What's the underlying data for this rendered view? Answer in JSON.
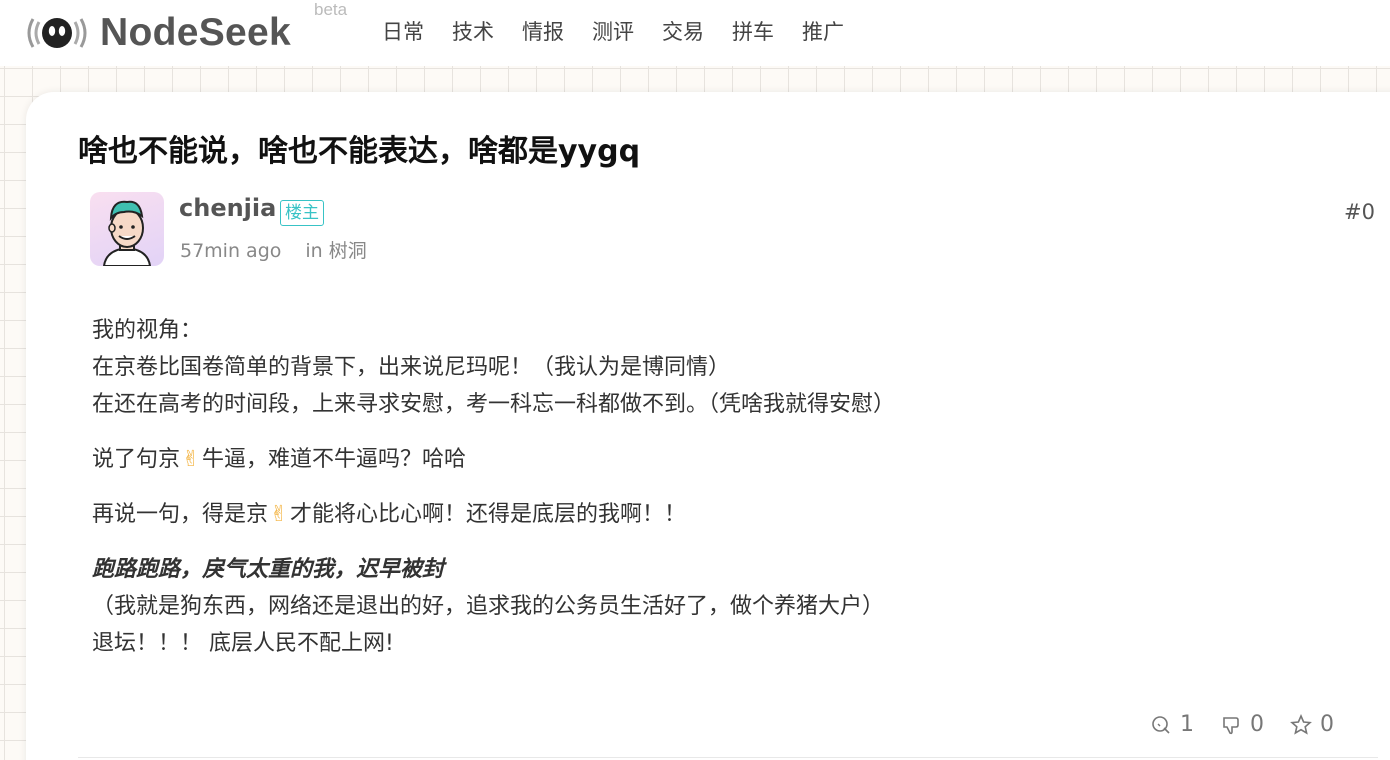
{
  "header": {
    "logo_text": "NodeSeek",
    "beta_label": "beta",
    "nav": [
      "日常",
      "技术",
      "情报",
      "测评",
      "交易",
      "拼车",
      "推广"
    ]
  },
  "post": {
    "title": "啥也不能说，啥也不能表达，啥都是yygq",
    "author": "chenjia",
    "badge": "楼主",
    "time": "57min ago",
    "category": "in 树洞",
    "floor": "#0",
    "content": {
      "p1_l1": "我的视角：",
      "p1_l2": "在京卷比国卷简单的背景下，出来说尼玛呢！（我认为是博同情）",
      "p1_l3": "在还在高考的时间段，上来寻求安慰，考一科忘一科都做不到。（凭啥我就得安慰）",
      "p2_a": "说了句京",
      "p2_b": "牛逼，难道不牛逼吗？哈哈",
      "p3_a": "再说一句，得是京",
      "p3_b": "才能将心比心啊！还得是底层的我啊！！",
      "p4_emph": "跑路跑路，戾气太重的我，迟早被封",
      "p4_l2": "（我就是狗东西，网络还是退出的好，追求我的公务员生活好了，做个养猪大户）",
      "p4_l3": "退坛！！！ 底层人民不配上网!"
    },
    "emoji": "✌",
    "actions": {
      "comment_count": "1",
      "dislike_count": "0",
      "star_count": "0"
    }
  },
  "colors": {
    "badge": "#38c3c6",
    "background": "#fdfaf6",
    "grid": "#e7e3de"
  },
  "icons": [
    "logo-icon",
    "comment-icon",
    "dislike-icon",
    "star-icon"
  ]
}
